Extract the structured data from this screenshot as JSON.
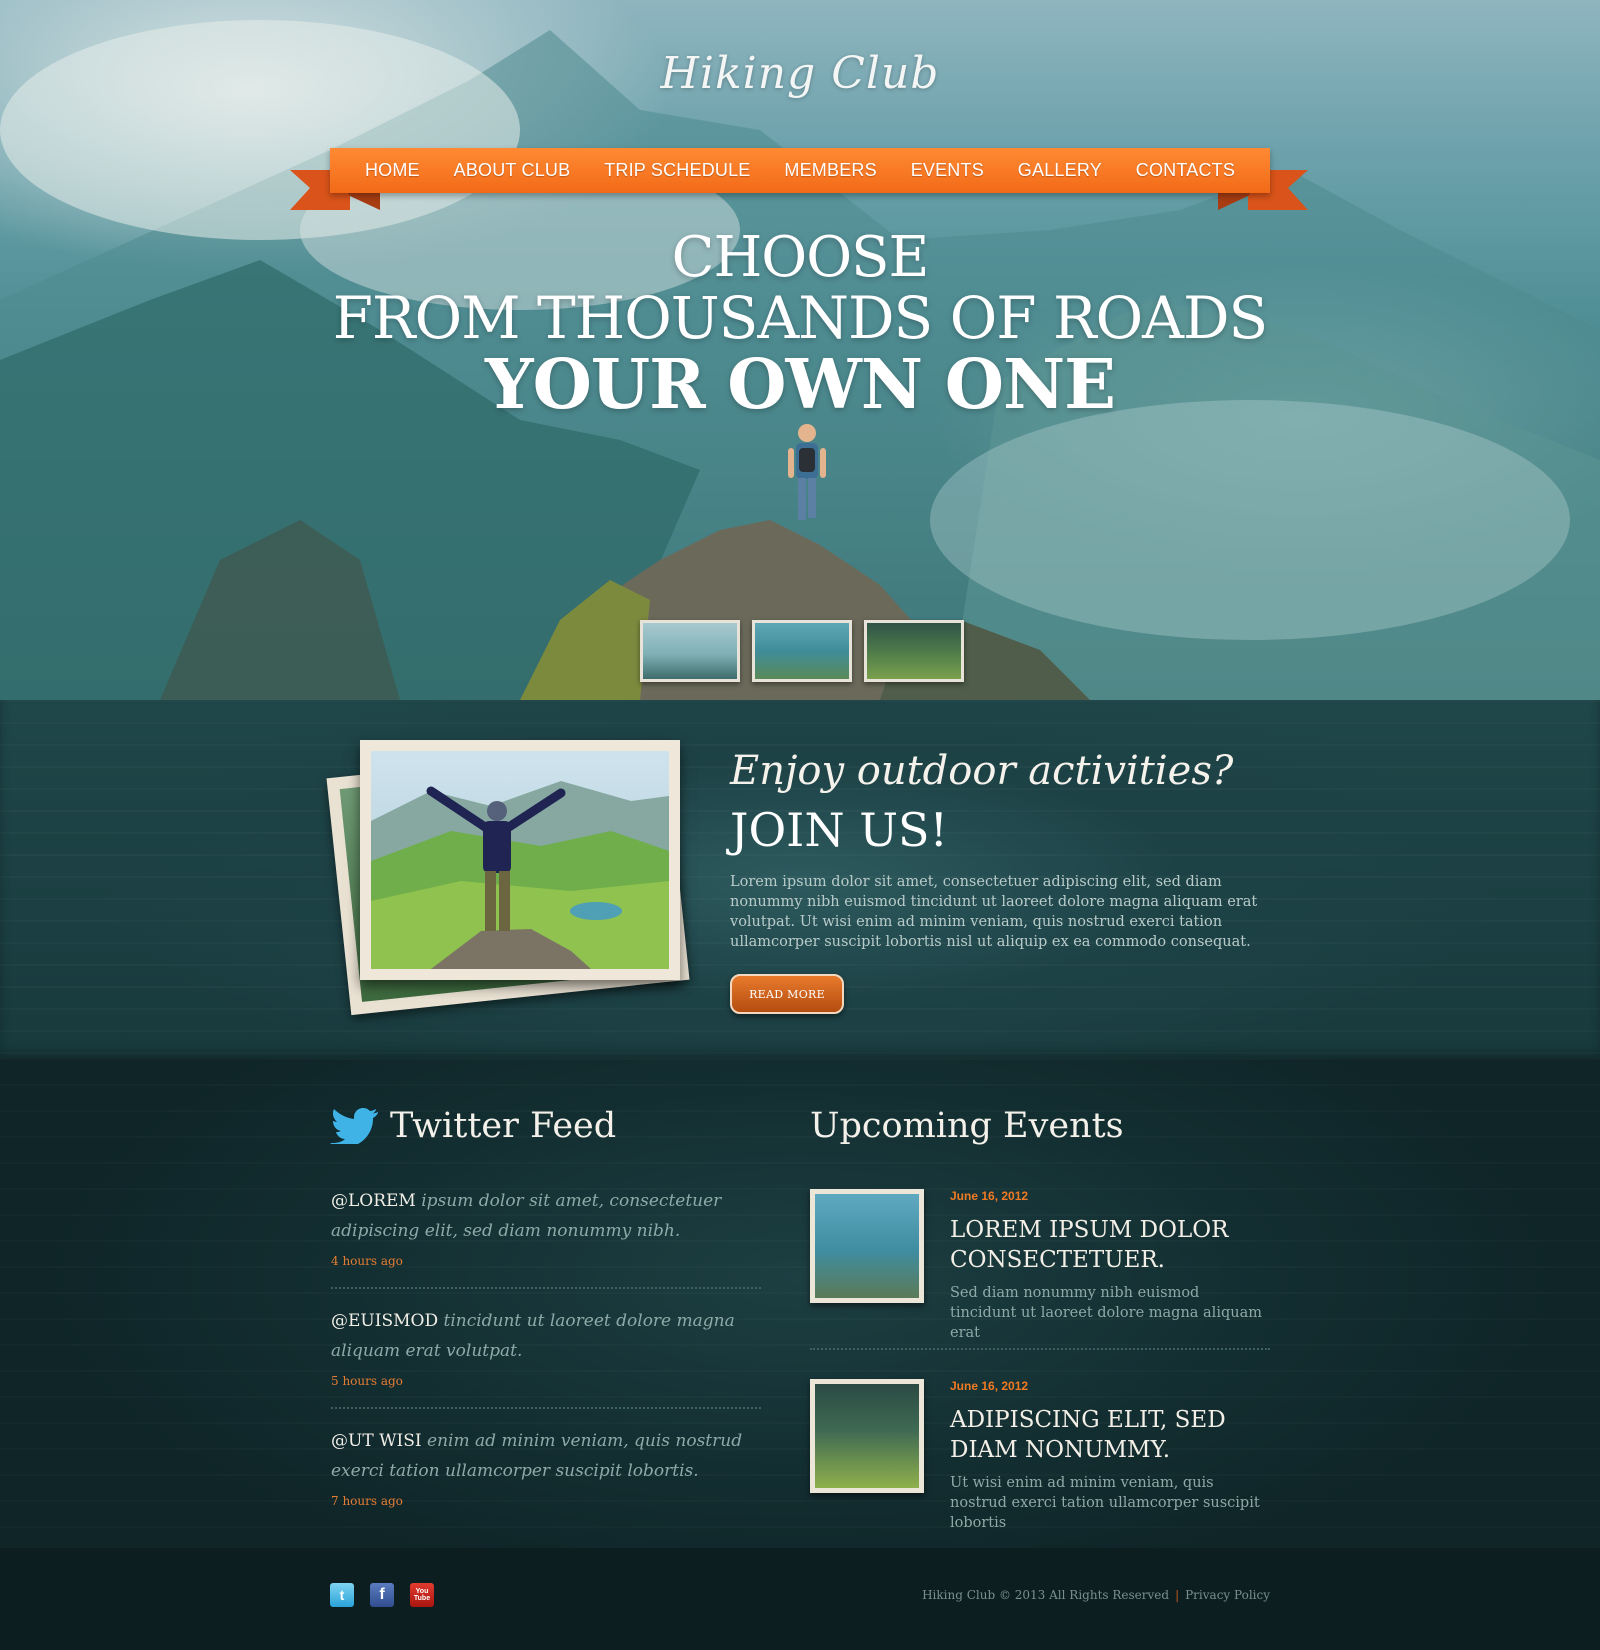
{
  "brand": {
    "logo_text": "Hiking Club"
  },
  "nav": {
    "items": [
      "HOME",
      "ABOUT CLUB",
      "TRIP SCHEDULE",
      "MEMBERS",
      "EVENTS",
      "GALLERY",
      "CONTACTS"
    ]
  },
  "hero": {
    "line1": "CHOOSE",
    "line2": "FROM THOUSANDS OF ROADS",
    "line3": "YOUR OWN ONE",
    "thumbnails": [
      "misty-hiker-thumb",
      "hiker-arms-up-thumb",
      "hikers-meadow-thumb"
    ]
  },
  "join": {
    "tagline": "Enjoy outdoor activities?",
    "title": "JOIN US!",
    "body": "Lorem ipsum dolor sit amet, consectetuer adipiscing elit, sed diam nonummy nibh euismod tincidunt ut laoreet dolore magna aliquam erat volutpat. Ut wisi enim ad minim veniam, quis nostrud exerci tation ullamcorper suscipit lobortis nisl ut aliquip ex ea commodo consequat.",
    "button": "READ MORE"
  },
  "twitter": {
    "title": "Twitter Feed",
    "tweets": [
      {
        "handle": "@LOREM",
        "text": " ipsum dolor sit amet, consectetuer adipiscing elit, sed diam nonummy nibh.",
        "time": "4 hours ago"
      },
      {
        "handle": "@EUISMOD",
        "text": " tincidunt ut laoreet dolore magna aliquam erat volutpat.",
        "time": "5 hours ago"
      },
      {
        "handle": "@UT WISI",
        "text": " enim ad minim veniam, quis nostrud exerci tation ullamcorper suscipit lobortis.",
        "time": "7 hours ago"
      }
    ]
  },
  "events": {
    "title": "Upcoming Events",
    "items": [
      {
        "date": "June 16, 2012",
        "title": "LOREM IPSUM DOLOR CONSECTETUER.",
        "desc": "Sed diam nonummy nibh euismod tincidunt ut laoreet dolore magna aliquam erat"
      },
      {
        "date": "June 16, 2012",
        "title": "ADIPISCING ELIT, SED DIAM NONUMMY.",
        "desc": "Ut wisi enim ad minim veniam, quis nostrud exerci tation ullamcorper suscipit lobortis"
      }
    ]
  },
  "footer": {
    "copyright": "Hiking Club © 2013 All Rights Reserved",
    "separator": "|",
    "privacy": "Privacy Policy",
    "social": {
      "twitter_glyph": "t",
      "facebook_glyph": "f",
      "youtube_line1": "You",
      "youtube_line2": "Tube"
    }
  },
  "colors": {
    "accent": "#f26a18",
    "date": "#f07a22",
    "bg_dark": "#0e2225"
  }
}
